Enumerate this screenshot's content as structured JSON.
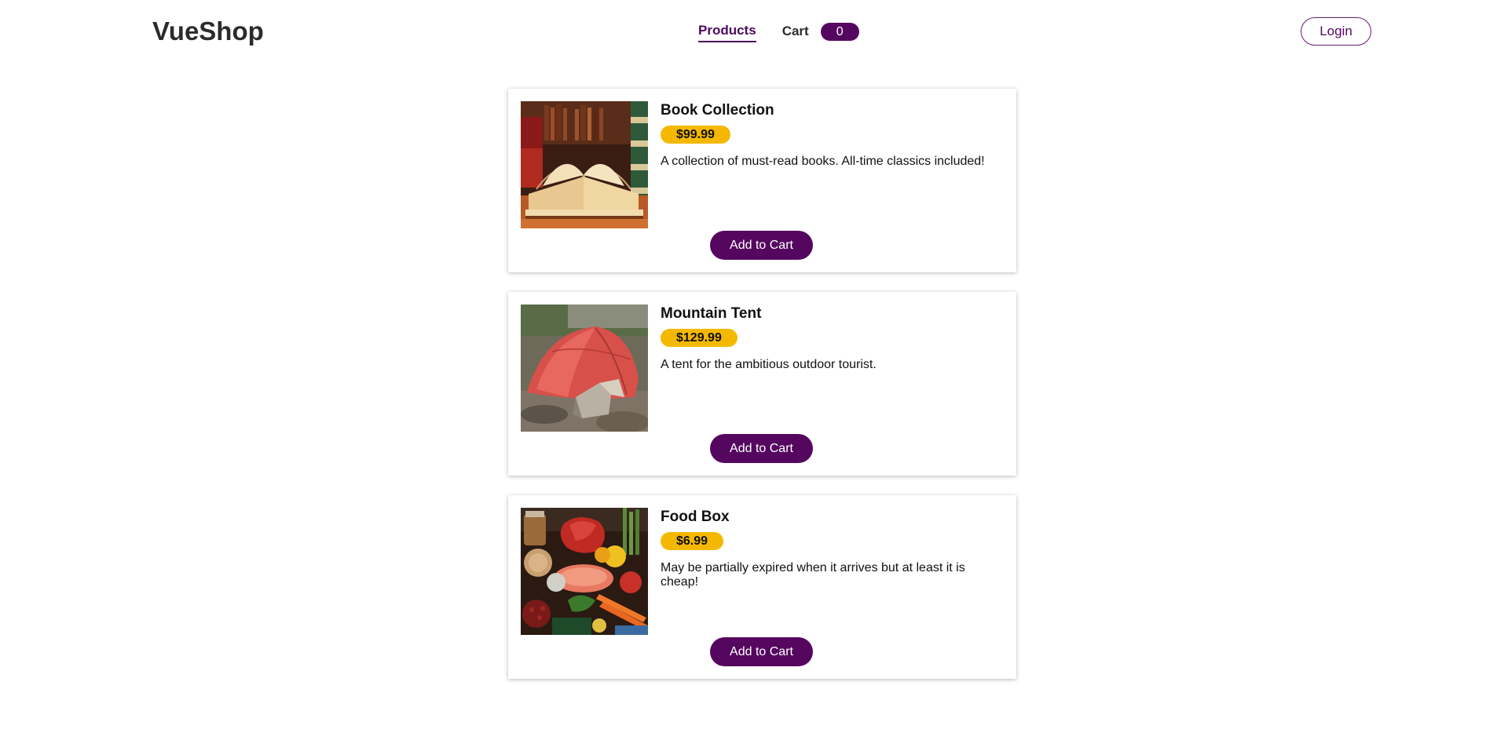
{
  "header": {
    "logo": "VueShop",
    "nav": {
      "products_label": "Products",
      "cart_label": "Cart",
      "cart_count": "0"
    },
    "login_label": "Login"
  },
  "products": [
    {
      "name": "Book Collection",
      "price": "$99.99",
      "description": "A collection of must-read books. All-time classics included!",
      "button_label": "Add to Cart",
      "image": "books-photo"
    },
    {
      "name": "Mountain Tent",
      "price": "$129.99",
      "description": "A tent for the ambitious outdoor tourist.",
      "button_label": "Add to Cart",
      "image": "red-tent-photo"
    },
    {
      "name": "Food Box",
      "price": "$6.99",
      "description": "May be partially expired when it arrives but at least it is cheap!",
      "button_label": "Add to Cart",
      "image": "food-assortment-photo"
    }
  ],
  "colors": {
    "brand": "#55075f",
    "price_badge": "#f5b800"
  }
}
